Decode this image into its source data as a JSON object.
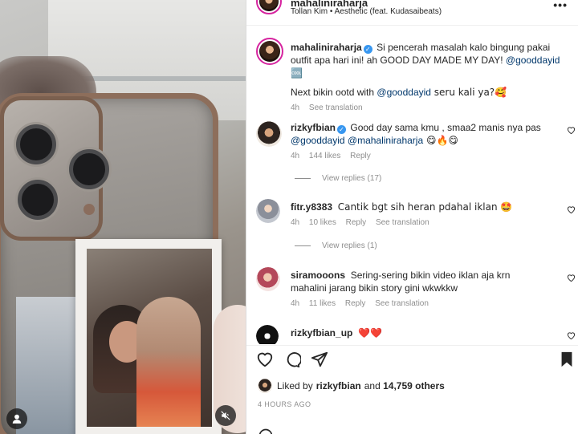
{
  "post_header": {
    "username": "mahaliniraharja",
    "song": "Tollan Kim • Aesthetic (feat. Kudasaibeats)",
    "more_label": "•••"
  },
  "caption": {
    "username": "mahaliniraharja",
    "text_before": "Si pencerah masalah kalo bingung pakai outfit apa hari ini! ah GOOD DAY MADE MY DAY! ",
    "mention": "@gooddayid",
    "emoji": "🆒",
    "line2_before": "Next bikin ootd with ",
    "line2_mention": "@gooddayid",
    "line2_after": " seru kali ya?🥰",
    "time": "4h",
    "translate": "See translation"
  },
  "comments": [
    {
      "username": "rizkyfbian",
      "verified": true,
      "text": "Good day sama kmu , smaa2 manis nya pas ",
      "mention": "@gooddayid @mahaliniraharja",
      "emoji": " 😋🔥😋",
      "time": "4h",
      "likes": "144 likes",
      "reply": "Reply",
      "view_replies": "View replies (17)"
    },
    {
      "username": "fitr.y8383",
      "text": "Cantik bgt sih heran pdahal iklan 🤩",
      "time": "4h",
      "likes": "10 likes",
      "reply": "Reply",
      "translate": "See translation",
      "view_replies": "View replies (1)"
    },
    {
      "username": "siramooons",
      "text": "Sering-sering bikin video iklan aja krn mahalini jarang bikin story gini wkwkkw",
      "time": "4h",
      "likes": "11 likes",
      "reply": "Reply",
      "translate": "See translation"
    },
    {
      "username": "rizkyfbian_up",
      "text": "❤️❤️"
    }
  ],
  "likes_bar": {
    "prefix": "Liked by",
    "user": "rizkyfbian",
    "middle": "and",
    "others": "14,759 others"
  },
  "timestamp": "4 HOURS AGO",
  "icons": {
    "like": "heart-outline-icon",
    "comment": "comment-bubble-icon",
    "share": "paper-plane-icon",
    "save": "bookmark-filled-icon",
    "tagged_user": "user-icon",
    "mute": "speaker-muted-icon"
  },
  "colors": {
    "mention": "#00376b",
    "verified": "#3897f0",
    "muted_text": "#8e8e8e",
    "story_ring": "#d6249f"
  }
}
